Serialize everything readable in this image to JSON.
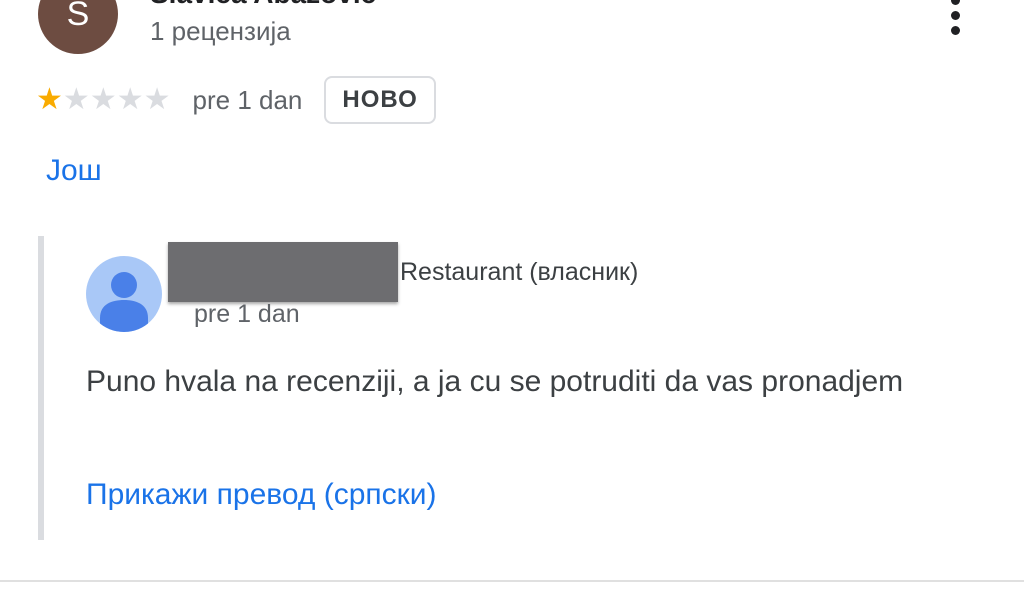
{
  "review": {
    "reviewer_initial": "S",
    "reviewer_name": "Slavica Abazović",
    "review_count": "1 рецензија",
    "menu_icon": "more-vert-icon",
    "rating": 1,
    "rating_max": 5,
    "date": "pre 1 dan",
    "new_badge": "НОВО",
    "more_link": "Још"
  },
  "owner_reply": {
    "avatar_icon": "person-icon",
    "owner_label": "Restaurant (власник)",
    "date": "pre 1 dan",
    "text": "Puno hvala na recenziji, a ja cu se potruditi da vas pronadjem",
    "translate_link": "Прикажи превод (српски)"
  },
  "colors": {
    "star_filled": "#f9ab00",
    "star_empty": "#dadce0",
    "link": "#1a73e8",
    "reviewer_avatar": "#6d4c41",
    "owner_avatar": "#a9c8f7"
  }
}
